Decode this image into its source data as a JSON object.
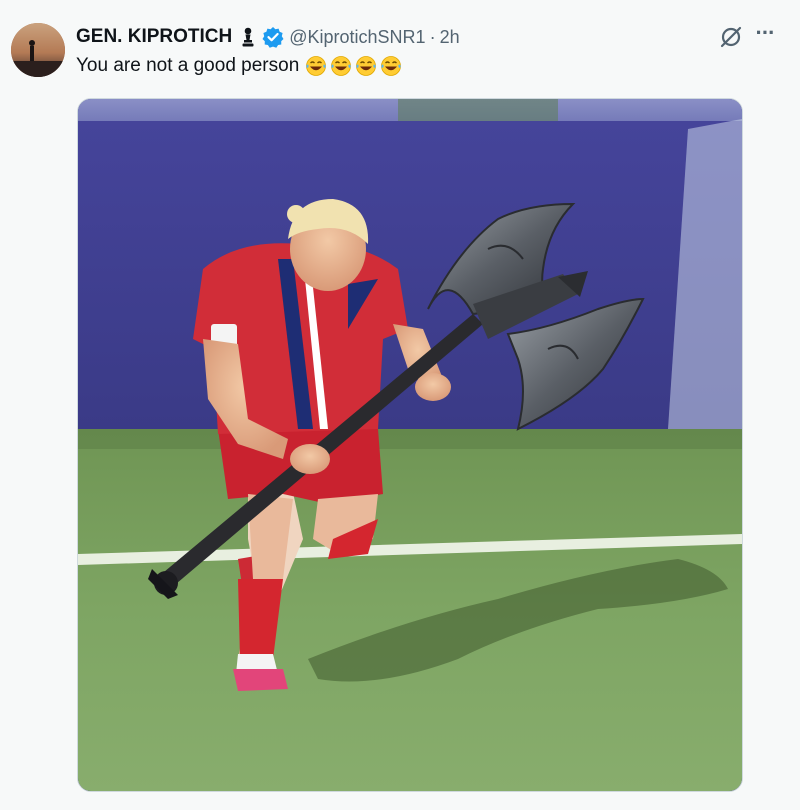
{
  "author": {
    "display_name": "GEN. KIPROTICH",
    "handle": "@KiprotichSNR1",
    "separator": "·",
    "time": "2h",
    "verified": true,
    "badge_icon": "chess-pawn-icon",
    "verified_icon": "verified-badge-icon"
  },
  "tweet": {
    "text": "You are not a good person",
    "emojis": [
      "😂",
      "😂",
      "😂",
      "😂"
    ]
  },
  "actions": {
    "grok_icon": "grok-icon",
    "more_icon": "more-icon",
    "more_label": "···"
  },
  "colors": {
    "verified": "#1d9bf0",
    "secondary_text": "#536471",
    "background": "#f7f9f9"
  },
  "media": {
    "type": "photo"
  }
}
